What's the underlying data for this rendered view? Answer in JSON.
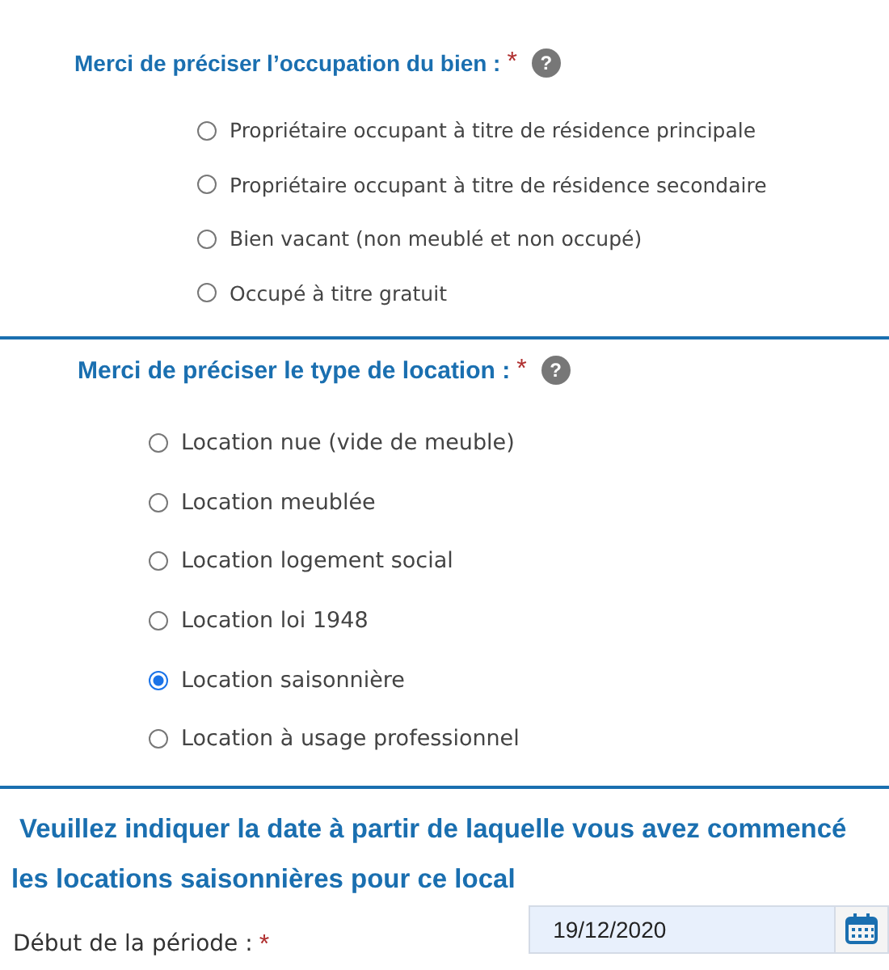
{
  "sections": [
    {
      "kind": "small",
      "question": "Merci de préciser l’occupation du bien :",
      "required_mark": "*",
      "help": "?",
      "options": [
        {
          "label": "Propriétaire occupant à titre de résidence principale",
          "selected": false
        },
        {
          "label": "Propriétaire occupant à titre de résidence secondaire",
          "selected": false
        },
        {
          "label": "Bien vacant (non meublé et non occupé)",
          "selected": false
        },
        {
          "label": "Occupé à titre gratuit",
          "selected": false
        }
      ]
    },
    {
      "kind": "large",
      "question": "Merci de préciser le type de location :",
      "required_mark": "*",
      "help": "?",
      "options": [
        {
          "label": "Location nue (vide de meuble)",
          "selected": false
        },
        {
          "label": "Location meublée",
          "selected": false
        },
        {
          "label": "Location logement social",
          "selected": false
        },
        {
          "label": "Location loi 1948",
          "selected": false
        },
        {
          "label": "Location saisonnière",
          "selected": true
        },
        {
          "label": "Location à usage professionnel",
          "selected": false
        }
      ]
    }
  ],
  "date_section": {
    "question_lines": [
      "Veuillez indiquer la date à partir de laquelle vous avez commencé",
      "les locations saisonnières pour ce local"
    ],
    "field": {
      "label": "Début de la période :",
      "required_mark": "*",
      "value": "19/12/2020"
    }
  }
}
